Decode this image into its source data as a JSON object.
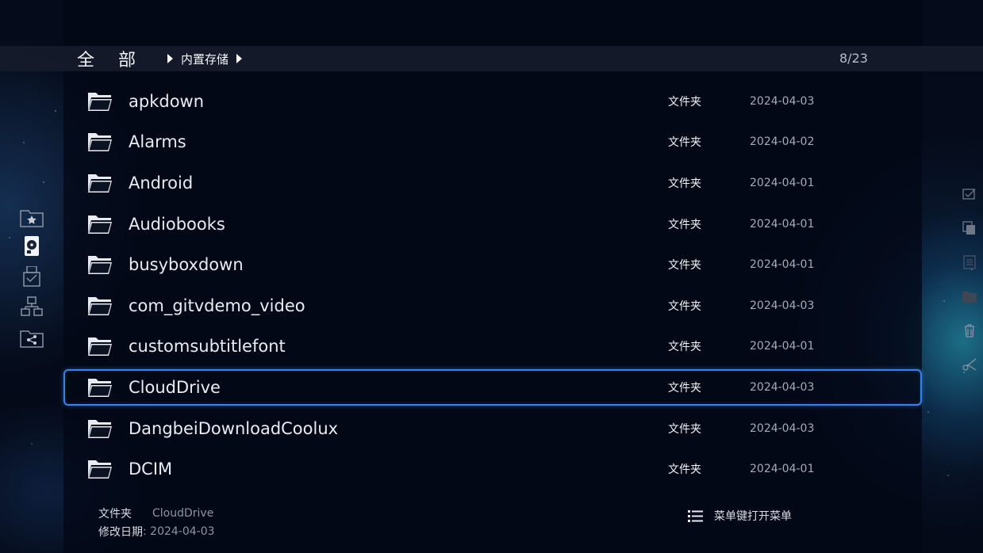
{
  "breadcrumb": {
    "root": "全部",
    "current": "内置存储"
  },
  "counter": "8/23",
  "files": [
    {
      "name": "apkdown",
      "type": "文件夹",
      "date": "2024-04-03"
    },
    {
      "name": "Alarms",
      "type": "文件夹",
      "date": "2024-04-02"
    },
    {
      "name": "Android",
      "type": "文件夹",
      "date": "2024-04-01"
    },
    {
      "name": "Audiobooks",
      "type": "文件夹",
      "date": "2024-04-01"
    },
    {
      "name": "busyboxdown",
      "type": "文件夹",
      "date": "2024-04-01"
    },
    {
      "name": "com_gitvdemo_video",
      "type": "文件夹",
      "date": "2024-04-03"
    },
    {
      "name": "customsubtitlefont",
      "type": "文件夹",
      "date": "2024-04-01"
    },
    {
      "name": "CloudDrive",
      "type": "文件夹",
      "date": "2024-04-03",
      "selected": true
    },
    {
      "name": "DangbeiDownloadCoolux",
      "type": "文件夹",
      "date": "2024-04-03"
    },
    {
      "name": "DCIM",
      "type": "文件夹",
      "date": "2024-04-01"
    }
  ],
  "footer": {
    "type_label": "文件夹",
    "type_value": "CloudDrive",
    "modified_label": "修改日期",
    "modified_value": ": 2024-04-03",
    "menu_hint": "菜单键打开菜单"
  },
  "left_nav_icons": [
    "favorites-folder-icon",
    "local-disk-icon",
    "usb-drive-icon",
    "network-icon",
    "share-folder-icon"
  ],
  "right_toolbar_icons": [
    "select-check-icon",
    "copy-icon",
    "paste-icon",
    "move-icon",
    "delete-icon",
    "cut-icon"
  ],
  "colors": {
    "accent": "#3a82e6",
    "background": "#040a18"
  }
}
